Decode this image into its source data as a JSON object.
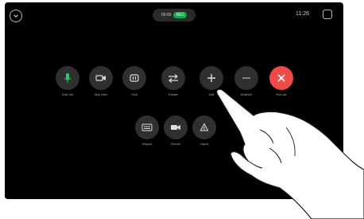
{
  "status_bar": {
    "call_badge_text": "00:00",
    "rec_badge_text": "REC",
    "time": "11:26"
  },
  "controls": {
    "row1": [
      {
        "name": "mute-mic-button",
        "icon": "mic-icon",
        "label": "Mute mic"
      },
      {
        "name": "stop-video-button",
        "icon": "camera-icon",
        "label": "Stop video"
      },
      {
        "name": "hold-button",
        "icon": "pause-icon",
        "label": "Hold"
      },
      {
        "name": "transfer-button",
        "icon": "transfer-arrows-icon",
        "label": "Transfer"
      },
      {
        "name": "add-button",
        "icon": "plus-icon",
        "label": "Add"
      },
      {
        "name": "minimize-button",
        "icon": "minus-icon",
        "label": "Minimize"
      },
      {
        "name": "end-call-button",
        "icon": "close-icon",
        "label": "End call"
      }
    ],
    "row2": [
      {
        "name": "keypad-button",
        "icon": "keypad-icon",
        "label": "Keypad"
      },
      {
        "name": "record-button",
        "icon": "record-icon",
        "label": "Record"
      },
      {
        "name": "layout-button",
        "icon": "layout-icon",
        "label": "Layout"
      }
    ]
  },
  "colors": {
    "screen_bg": "#000000",
    "button_bg": "#2f2f2f",
    "end_call": "#ef4a48",
    "recording": "#13a84a"
  }
}
